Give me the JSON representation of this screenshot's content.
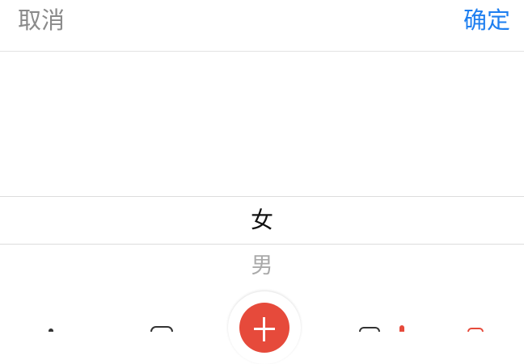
{
  "toolbar": {
    "cancel_label": "取消",
    "confirm_label": "确定"
  },
  "picker": {
    "selected": "女",
    "options": [
      "女",
      "男"
    ]
  },
  "colors": {
    "accent": "#1e7ff0",
    "fab": "#e64a3b"
  },
  "tabbar": {
    "icons": [
      "home-icon",
      "discover-icon",
      "add-icon",
      "message-icon",
      "profile-icon"
    ]
  }
}
